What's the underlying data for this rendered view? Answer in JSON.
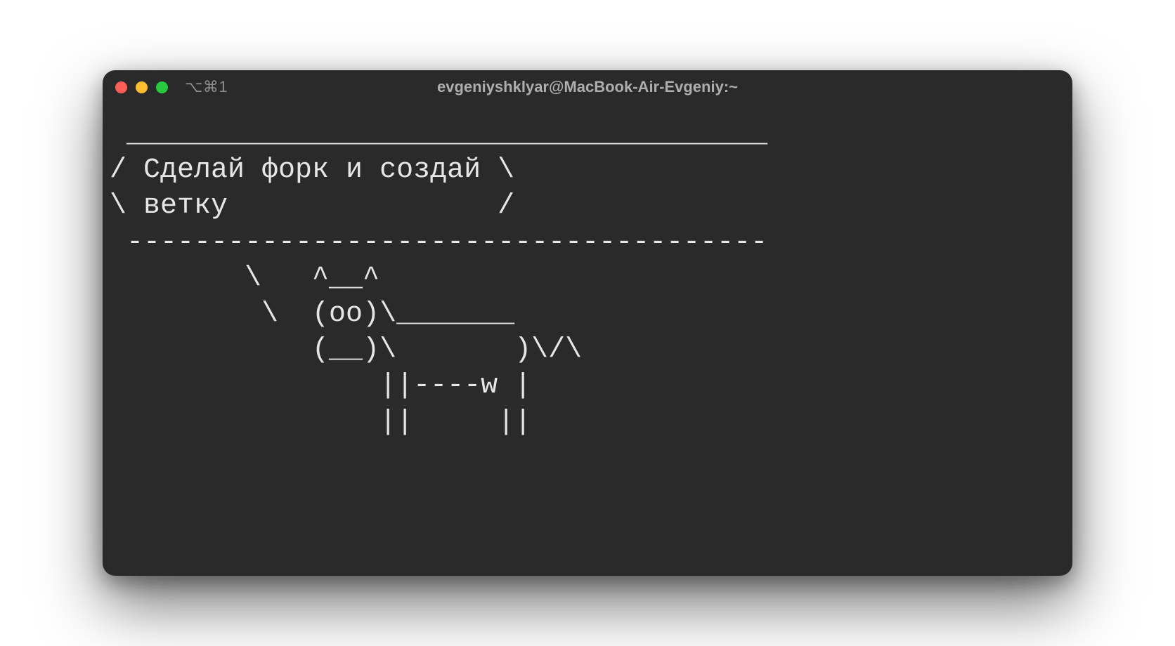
{
  "window": {
    "profile_indicator": "⌥⌘1",
    "title": "evgeniyshklyar@MacBook-Air-Evgeniy:~"
  },
  "terminal": {
    "output": " ______________________________________\n/ Сделай форк и создай \\\n\\ ветку                /\n --------------------------------------\n        \\   ^__^\n         \\  (oo)\\_______\n            (__)\\       )\\/\\\n                ||----w |\n                ||     ||"
  },
  "colors": {
    "window_bg": "#2a2a2a",
    "text": "#e6e6e6",
    "titlebar_text": "#aeaeae",
    "traffic_close": "#ff5f57",
    "traffic_min": "#febc2e",
    "traffic_zoom": "#28c840"
  }
}
